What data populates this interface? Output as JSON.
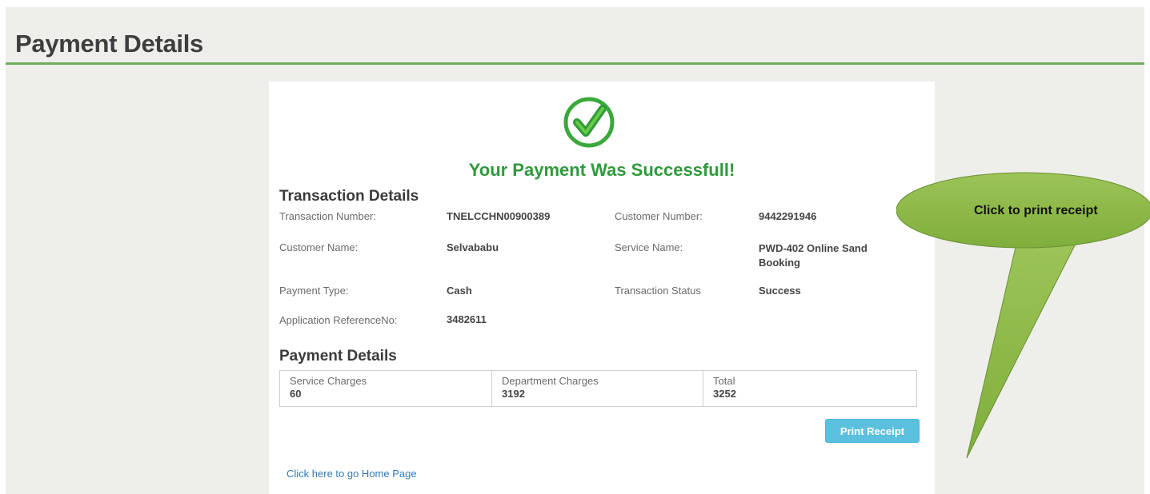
{
  "page": {
    "title": "Payment Details"
  },
  "success": {
    "message": "Your Payment Was Successfull!"
  },
  "transaction": {
    "heading": "Transaction Details",
    "transaction_number_label": "Transaction Number:",
    "transaction_number": "TNELCCHN00900389",
    "customer_number_label": "Customer Number:",
    "customer_number": "9442291946",
    "customer_name_label": "Customer Name:",
    "customer_name": "Selvababu",
    "service_name_label": "Service Name:",
    "service_name": "PWD-402 Online Sand Booking",
    "payment_type_label": "Payment Type:",
    "payment_type": "Cash",
    "transaction_status_label": "Transaction Status",
    "transaction_status": "Success",
    "app_ref_label": "Application ReferenceNo:",
    "app_ref": "3482611"
  },
  "payment": {
    "heading": "Payment Details",
    "columns": [
      {
        "label": "Service Charges",
        "value": "60"
      },
      {
        "label": "Department Charges",
        "value": "3192"
      },
      {
        "label": "Total",
        "value": "3252"
      }
    ],
    "print_label": "Print Receipt"
  },
  "home_link": "Click here to go Home Page",
  "callout": {
    "text": "Click to print receipt"
  },
  "icons": {
    "success": "check-circle-icon"
  },
  "colors": {
    "accent_green": "#6db05c",
    "success_green": "#2f9a3c",
    "button_blue": "#5bc0de",
    "link_blue": "#337ab7",
    "callout_green": "#8fbb4a"
  }
}
